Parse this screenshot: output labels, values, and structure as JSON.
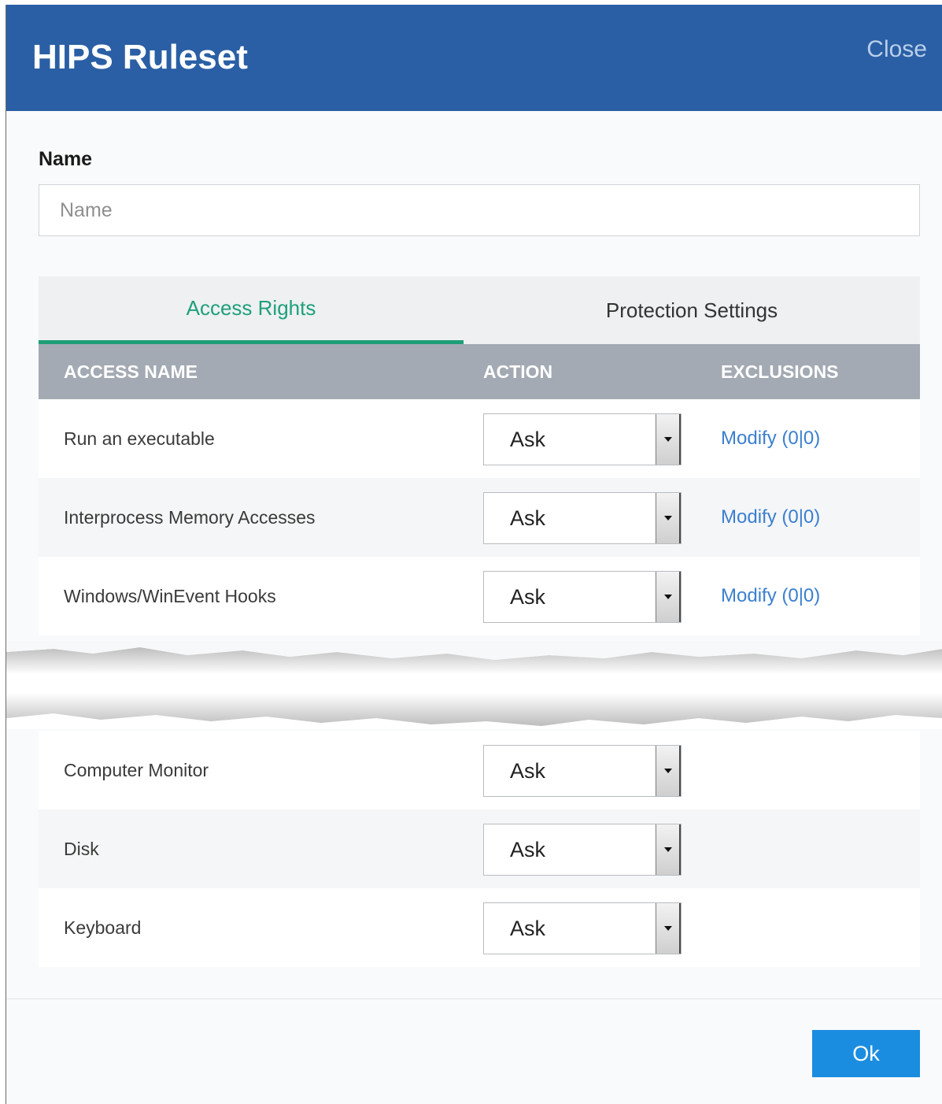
{
  "dialog": {
    "title": "HIPS Ruleset",
    "close_label": "Close",
    "ok_label": "Ok"
  },
  "name_field": {
    "label": "Name",
    "placeholder": "Name",
    "value": ""
  },
  "tabs": [
    {
      "label": "Access Rights",
      "active": true
    },
    {
      "label": "Protection Settings",
      "active": false
    }
  ],
  "table": {
    "columns": [
      "ACCESS NAME",
      "ACTION",
      "EXCLUSIONS"
    ],
    "rows_top": [
      {
        "name": "Run an executable",
        "action": "Ask",
        "exclusions": "Modify (0|0)"
      },
      {
        "name": "Interprocess Memory Accesses",
        "action": "Ask",
        "exclusions": "Modify (0|0)"
      },
      {
        "name": "Windows/WinEvent Hooks",
        "action": "Ask",
        "exclusions": "Modify (0|0)"
      }
    ],
    "rows_bottom": [
      {
        "name": "Computer Monitor",
        "action": "Ask"
      },
      {
        "name": "Disk",
        "action": "Ask"
      },
      {
        "name": "Keyboard",
        "action": "Ask"
      }
    ]
  },
  "colors": {
    "header": "#2a5fa5",
    "tab_active": "#1fa07a",
    "table_header": "#a3aab3",
    "link": "#3b7fd0",
    "ok_button": "#1b8de0"
  }
}
